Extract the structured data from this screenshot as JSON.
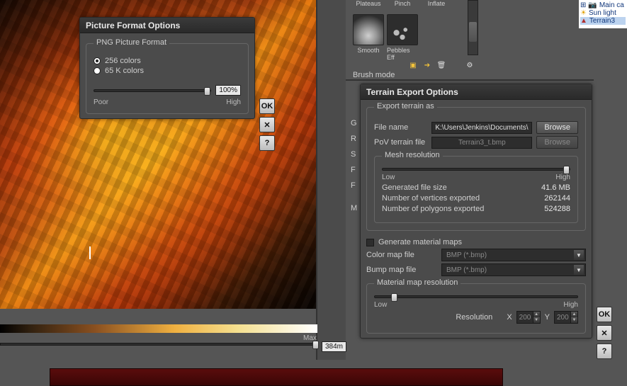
{
  "picture_format": {
    "title": "Picture Format Options",
    "group": "PNG Picture Format",
    "radio1": "256 colors",
    "radio2": "65 K colors",
    "low": "Poor",
    "high": "High",
    "pct": "100%"
  },
  "dialog_buttons": {
    "ok": "OK",
    "cancel": "✕",
    "help": "?"
  },
  "brushes_top": {
    "items": [
      {
        "label": "Plateaus"
      },
      {
        "label": "Pinch"
      },
      {
        "label": "Inflate"
      }
    ]
  },
  "brushes_bottom": {
    "items": [
      {
        "label": "Smooth"
      },
      {
        "label": "Pebbles Eff"
      }
    ]
  },
  "brush_mode_label": "Brush mode",
  "side_letters": [
    "G",
    "R",
    "S",
    "F",
    "F",
    "",
    "M"
  ],
  "terrain_export": {
    "title": "Terrain Export Options",
    "group_export": "Export terrain as",
    "file_name_label": "File name",
    "file_name_value": "K:\\Users\\Jenkins\\Documents\\e",
    "browse": "Browse",
    "pov_label": "PoV terrain file",
    "pov_value": "Terrain3_t.bmp",
    "mesh_res_label": "Mesh resolution",
    "low": "Low",
    "high": "High",
    "gen_size_label": "Generated file size",
    "gen_size_value": "41.6 MB",
    "verts_label": "Number of vertices exported",
    "verts_value": "262144",
    "polys_label": "Number of polygons exported",
    "polys_value": "524288",
    "gen_maps_label": "Generate material maps",
    "color_map_label": "Color map file",
    "color_map_value": "BMP (*.bmp)",
    "bump_map_label": "Bump map file",
    "bump_map_value": "BMP (*.bmp)",
    "mat_res_label": "Material map resolution",
    "res_label": "Resolution",
    "x_label": "X",
    "y_label": "Y",
    "x_val": "200",
    "y_val": "200"
  },
  "scale": {
    "max": "Max",
    "dist": "384m"
  },
  "scene_tree": {
    "items": [
      {
        "label": "Main ca"
      },
      {
        "label": "Sun light"
      },
      {
        "label": "Terrain3",
        "selected": true
      }
    ]
  }
}
